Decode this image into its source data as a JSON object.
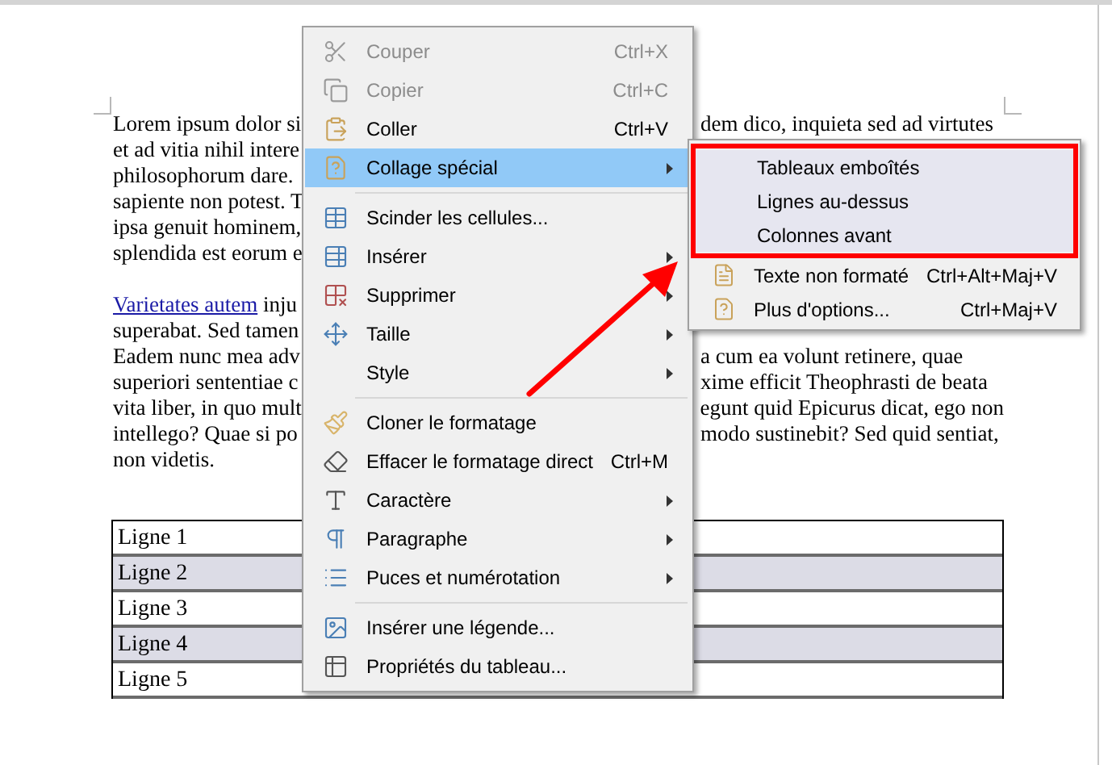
{
  "document": {
    "paragraphs": [
      {
        "lines": [
          {
            "left": "Lorem ipsum dolor si",
            "right": "dem dico, inquieta sed ad virtutes"
          },
          {
            "left": "et ad vitia nihil intere"
          },
          {
            "left": "philosophorum dare."
          },
          {
            "left": "sapiente non potest. T"
          },
          {
            "left": "ipsa genuit hominem,"
          },
          {
            "left": "splendida est eorum e"
          }
        ]
      },
      {
        "lines": [
          {
            "link": "Varietates autem",
            "left": " inju"
          },
          {
            "left": "superabat. Sed tamen"
          },
          {
            "left": "Eadem nunc mea adv",
            "right": "a cum ea volunt retinere, quae"
          },
          {
            "left": "superiori sententiae c",
            "right": "xime efficit Theophrasti de beata"
          },
          {
            "left": "vita liber, in quo mult",
            "right": "egunt quid Epicurus dicat, ego non"
          },
          {
            "left": "intellego? Quae si po",
            "right": "modo sustinebit? Sed quid sentiat,"
          },
          {
            "left": "non videtis."
          }
        ]
      }
    ],
    "table": {
      "rows": [
        {
          "label": "Ligne 1",
          "shaded": false
        },
        {
          "label": "Ligne 2",
          "shaded": true
        },
        {
          "label": "Ligne 3",
          "shaded": false
        },
        {
          "label": "Ligne 4",
          "shaded": true
        },
        {
          "label": "Ligne 5",
          "shaded": false
        }
      ]
    }
  },
  "context_menu": {
    "items": [
      {
        "kind": "item",
        "label": "Couper",
        "shortcut": "Ctrl+X",
        "disabled": true,
        "selected": false,
        "submenu": false
      },
      {
        "kind": "item",
        "label": "Copier",
        "shortcut": "Ctrl+C",
        "disabled": true,
        "selected": false,
        "submenu": false
      },
      {
        "kind": "item",
        "label": "Coller",
        "shortcut": "Ctrl+V",
        "disabled": false,
        "selected": false,
        "submenu": false
      },
      {
        "kind": "item",
        "label": "Collage spécial",
        "disabled": false,
        "selected": true,
        "submenu": true
      },
      {
        "kind": "separator"
      },
      {
        "kind": "item",
        "label": "Scinder les cellules...",
        "disabled": false,
        "selected": false,
        "submenu": false
      },
      {
        "kind": "item",
        "label": "Insérer",
        "disabled": false,
        "selected": false,
        "submenu": true
      },
      {
        "kind": "item",
        "label": "Supprimer",
        "disabled": false,
        "selected": false,
        "submenu": true
      },
      {
        "kind": "item",
        "label": "Taille",
        "disabled": false,
        "selected": false,
        "submenu": true
      },
      {
        "kind": "item",
        "label": "Style",
        "disabled": false,
        "selected": false,
        "submenu": true
      },
      {
        "kind": "separator"
      },
      {
        "kind": "item",
        "label": "Cloner le formatage",
        "disabled": false,
        "selected": false,
        "submenu": false
      },
      {
        "kind": "item",
        "label": "Effacer le formatage direct",
        "shortcut": "Ctrl+M",
        "disabled": false,
        "selected": false,
        "submenu": false
      },
      {
        "kind": "item",
        "label": "Caractère",
        "disabled": false,
        "selected": false,
        "submenu": true
      },
      {
        "kind": "item",
        "label": "Paragraphe",
        "disabled": false,
        "selected": false,
        "submenu": true
      },
      {
        "kind": "item",
        "label": "Puces et numérotation",
        "disabled": false,
        "selected": false,
        "submenu": true
      },
      {
        "kind": "separator"
      },
      {
        "kind": "item",
        "label": "Insérer une légende...",
        "disabled": false,
        "selected": false,
        "submenu": false
      },
      {
        "kind": "item",
        "label": "Propriétés du tableau...",
        "disabled": false,
        "selected": false,
        "submenu": false
      }
    ]
  },
  "submenu": {
    "items": [
      {
        "label": "Tableaux emboîtés",
        "boxed": true
      },
      {
        "label": "Lignes au-dessus",
        "boxed": true
      },
      {
        "label": "Colonnes avant",
        "boxed": true
      },
      {
        "label": "Texte non formaté",
        "shortcut": "Ctrl+Alt+Maj+V",
        "boxed": false
      },
      {
        "label": "Plus d'options...",
        "shortcut": "Ctrl+Maj+V",
        "boxed": false
      }
    ]
  }
}
